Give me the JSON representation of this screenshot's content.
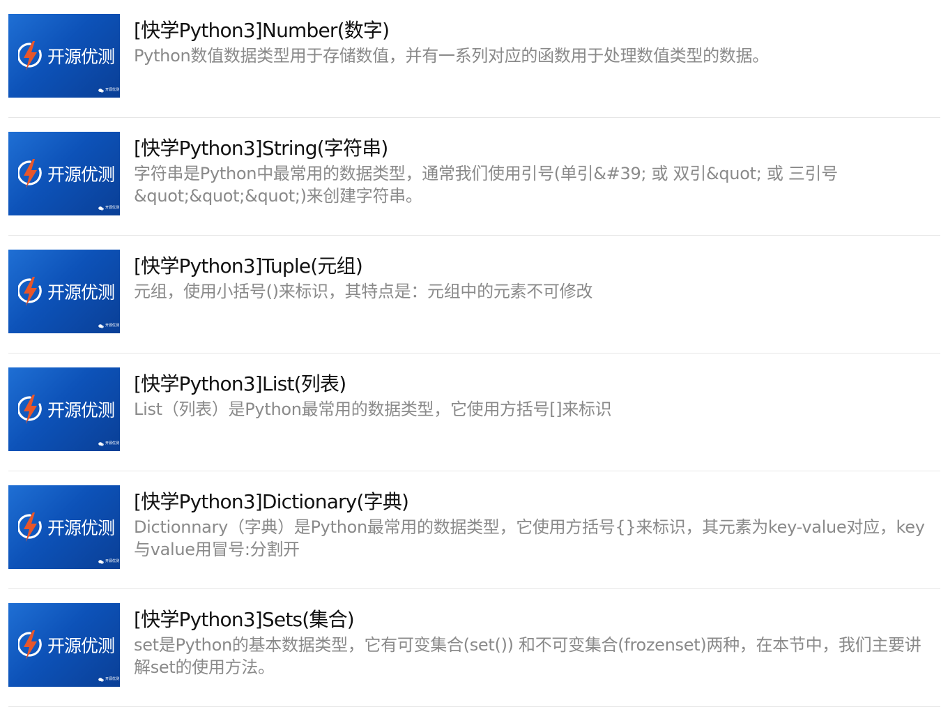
{
  "thumbnail": {
    "brand": "开源优测",
    "watermark": "开源优测"
  },
  "articles": [
    {
      "title": "[快学Python3]Number(数字)",
      "desc": "Python数值数据类型用于存储数值，并有一系列对应的函数用于处理数值类型的数据。"
    },
    {
      "title": "[快学Python3]String(字符串)",
      "desc": "字符串是Python中最常用的数据类型，通常我们使用引号(单引&#39; 或 双引&quot; 或 三引号&quot;&quot;&quot;)来创建字符串。"
    },
    {
      "title": "[快学Python3]Tuple(元组)",
      "desc": "元组，使用小括号()来标识，其特点是：元组中的元素不可修改"
    },
    {
      "title": "[快学Python3]List(列表)",
      "desc": "List（列表）是Python最常用的数据类型，它使用方括号[]来标识"
    },
    {
      "title": "[快学Python3]Dictionary(字典)",
      "desc": "Dictionnary（字典）是Python最常用的数据类型，它使用方括号{}来标识，其元素为key-value对应，key与value用冒号:分割开"
    },
    {
      "title": "[快学Python3]Sets(集合)",
      "desc": "set是Python的基本数据类型，它有可变集合(set()) 和不可变集合(frozenset)两种，在本节中，我们主要讲解set的使用方法。"
    }
  ],
  "icons": {
    "logo": "lightning-ring-logo-icon",
    "watermark": "wechat-icon"
  },
  "colors": {
    "thumb_blue": "#0d52b8",
    "logo_orange": "#e8562a",
    "title": "#111111",
    "desc": "#8a8a8a",
    "divider": "#e6e6e6"
  }
}
